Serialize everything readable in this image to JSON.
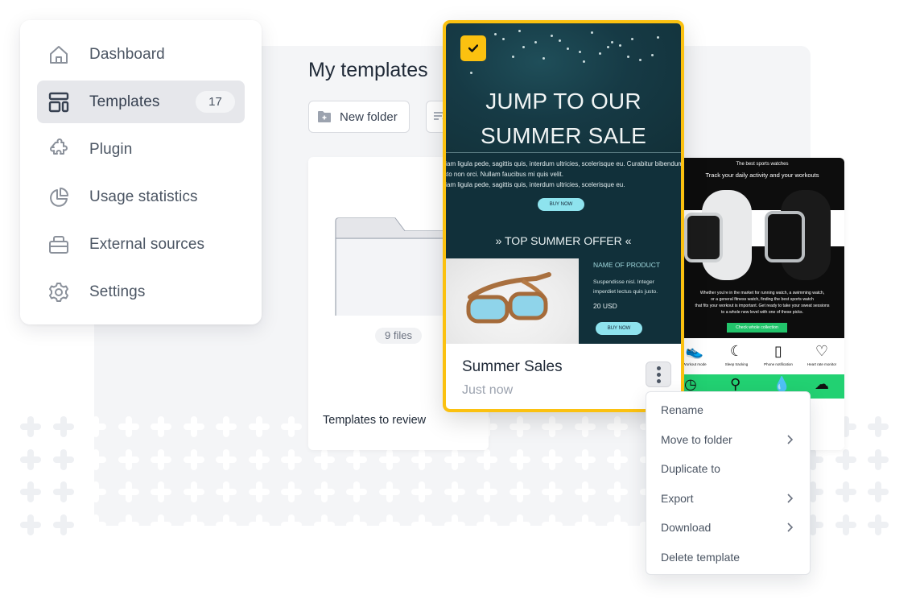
{
  "sidebar": {
    "items": [
      {
        "label": "Dashboard",
        "icon": "home-icon",
        "active": false
      },
      {
        "label": "Templates",
        "icon": "templates-layout-icon",
        "active": true,
        "badge": "17"
      },
      {
        "label": "Plugin",
        "icon": "puzzle-icon",
        "active": false
      },
      {
        "label": "Usage statistics",
        "icon": "pie-chart-icon",
        "active": false
      },
      {
        "label": "External sources",
        "icon": "stack-icon",
        "active": false
      },
      {
        "label": "Settings",
        "icon": "gear-icon",
        "active": false
      }
    ]
  },
  "main": {
    "title": "My templates",
    "toolbar": {
      "new_folder_label": "New folder",
      "new_folder_icon": "folder-plus-icon",
      "sort_icon": "sort-filter-icon"
    },
    "folder": {
      "name": "Templates to review",
      "file_count": "9 files"
    },
    "selected_template": {
      "name": "Summer Sales",
      "updated": "Just now",
      "selected": true,
      "check_icon": "checkmark-icon",
      "more_icon": "kebab-menu-icon",
      "preview": {
        "headline_line1": "JUMP TO OUR",
        "headline_line2": "SUMMER SALE",
        "lorem_1": "tiam ligula pede, sagittis quis, interdum ultricies, scelerisque eu. Curabitur bibendum",
        "lorem_2": "sto non orci. Nullam faucibus mi quis velit.",
        "lorem_3": "tiam ligula pede, sagittis quis, interdum ultricies, scelerisque eu.",
        "buy_now": "BUY NOW",
        "offer": "» TOP SUMMER OFFER «",
        "product_name": "NAME OF PRODUCT",
        "product_desc_1": "Suspendisse nisl. Integer",
        "product_desc_2": "imperdiet lectus quis justo.",
        "product_price": "20 USD",
        "product_buy": "BUY NOW"
      }
    },
    "watch_template": {
      "preview": {
        "small_heading": "The best sports watches",
        "heading": "Track your daily activity and your workouts",
        "paragraph_1": "Whether you're in the market for running watch, a swimming watch,",
        "paragraph_2": "or a general fitness watch, finding the best sports watch",
        "paragraph_3": "that fits your workout is important. Get ready to take your sweat sessions",
        "paragraph_4": "to a whole new level with one of these picks.",
        "cta": "Check whole collection",
        "features": [
          {
            "label": "Workout mode",
            "icon": "sneaker-icon"
          },
          {
            "label": "Sleep tracking",
            "icon": "sleep-moon-icon"
          },
          {
            "label": "Phone notification",
            "icon": "phone-icon"
          },
          {
            "label": "Heart rate monitor",
            "icon": "heart-rate-icon"
          }
        ],
        "green_icons": [
          "clock-icon",
          "location-pin-icon",
          "water-drop-icon",
          "weather-icon"
        ]
      }
    }
  },
  "context_menu": {
    "items": [
      {
        "label": "Rename",
        "submenu": false
      },
      {
        "label": "Move to folder",
        "submenu": true
      },
      {
        "label": "Duplicate to",
        "submenu": false
      },
      {
        "label": "Export",
        "submenu": true
      },
      {
        "label": "Download",
        "submenu": true
      },
      {
        "label": "Delete template",
        "submenu": false
      }
    ]
  },
  "colors": {
    "accent": "#fbc110",
    "active_nav_bg": "#e6e7eb",
    "text_primary": "#1f2937",
    "text_secondary": "#4b5563",
    "muted": "#9ca3af",
    "email_teal": "#11303a",
    "email_button": "#8ee3ee",
    "watch_green": "#22d172"
  }
}
